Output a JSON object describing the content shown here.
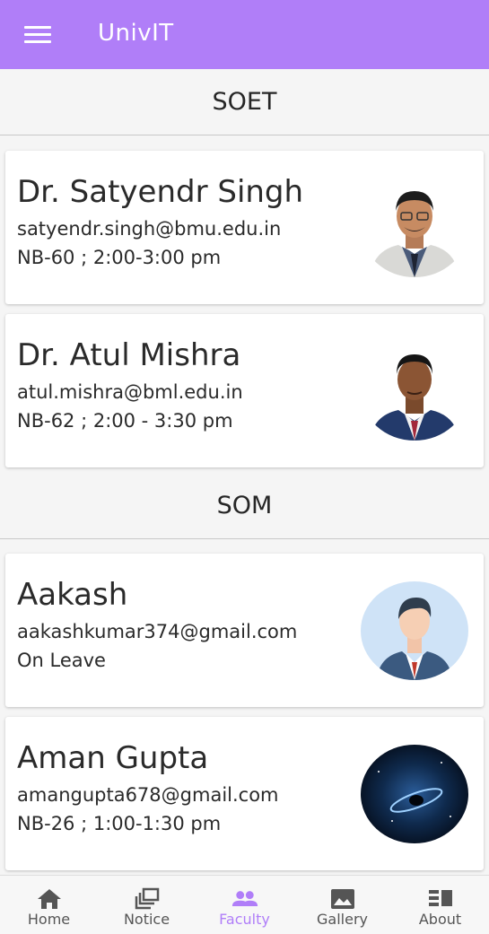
{
  "app": {
    "title": "UnivIT"
  },
  "colors": {
    "accent": "#b07ef8",
    "inactive": "#555555"
  },
  "sections": [
    {
      "title": "SOET",
      "faculty": [
        {
          "name": "Dr. Satyendr Singh",
          "email": "satyendr.singh@bmu.edu.in",
          "hours": "NB-60 ; 2:00-3:00 pm"
        },
        {
          "name": "Dr. Atul Mishra",
          "email": "atul.mishra@bml.edu.in",
          "hours": "NB-62 ; 2:00 - 3:30 pm"
        }
      ]
    },
    {
      "title": "SOM",
      "faculty": [
        {
          "name": "Aakash",
          "email": "aakashkumar374@gmail.com",
          "hours": "On Leave"
        },
        {
          "name": "Aman Gupta",
          "email": "amangupta678@gmail.com",
          "hours": "NB-26 ; 1:00-1:30 pm"
        }
      ]
    }
  ],
  "bottom_nav": [
    {
      "label": "Home",
      "icon": "home-icon"
    },
    {
      "label": "Notice",
      "icon": "notice-icon"
    },
    {
      "label": "Faculty",
      "icon": "faculty-icon",
      "active": true
    },
    {
      "label": "Gallery",
      "icon": "gallery-icon"
    },
    {
      "label": "About",
      "icon": "about-icon"
    }
  ]
}
